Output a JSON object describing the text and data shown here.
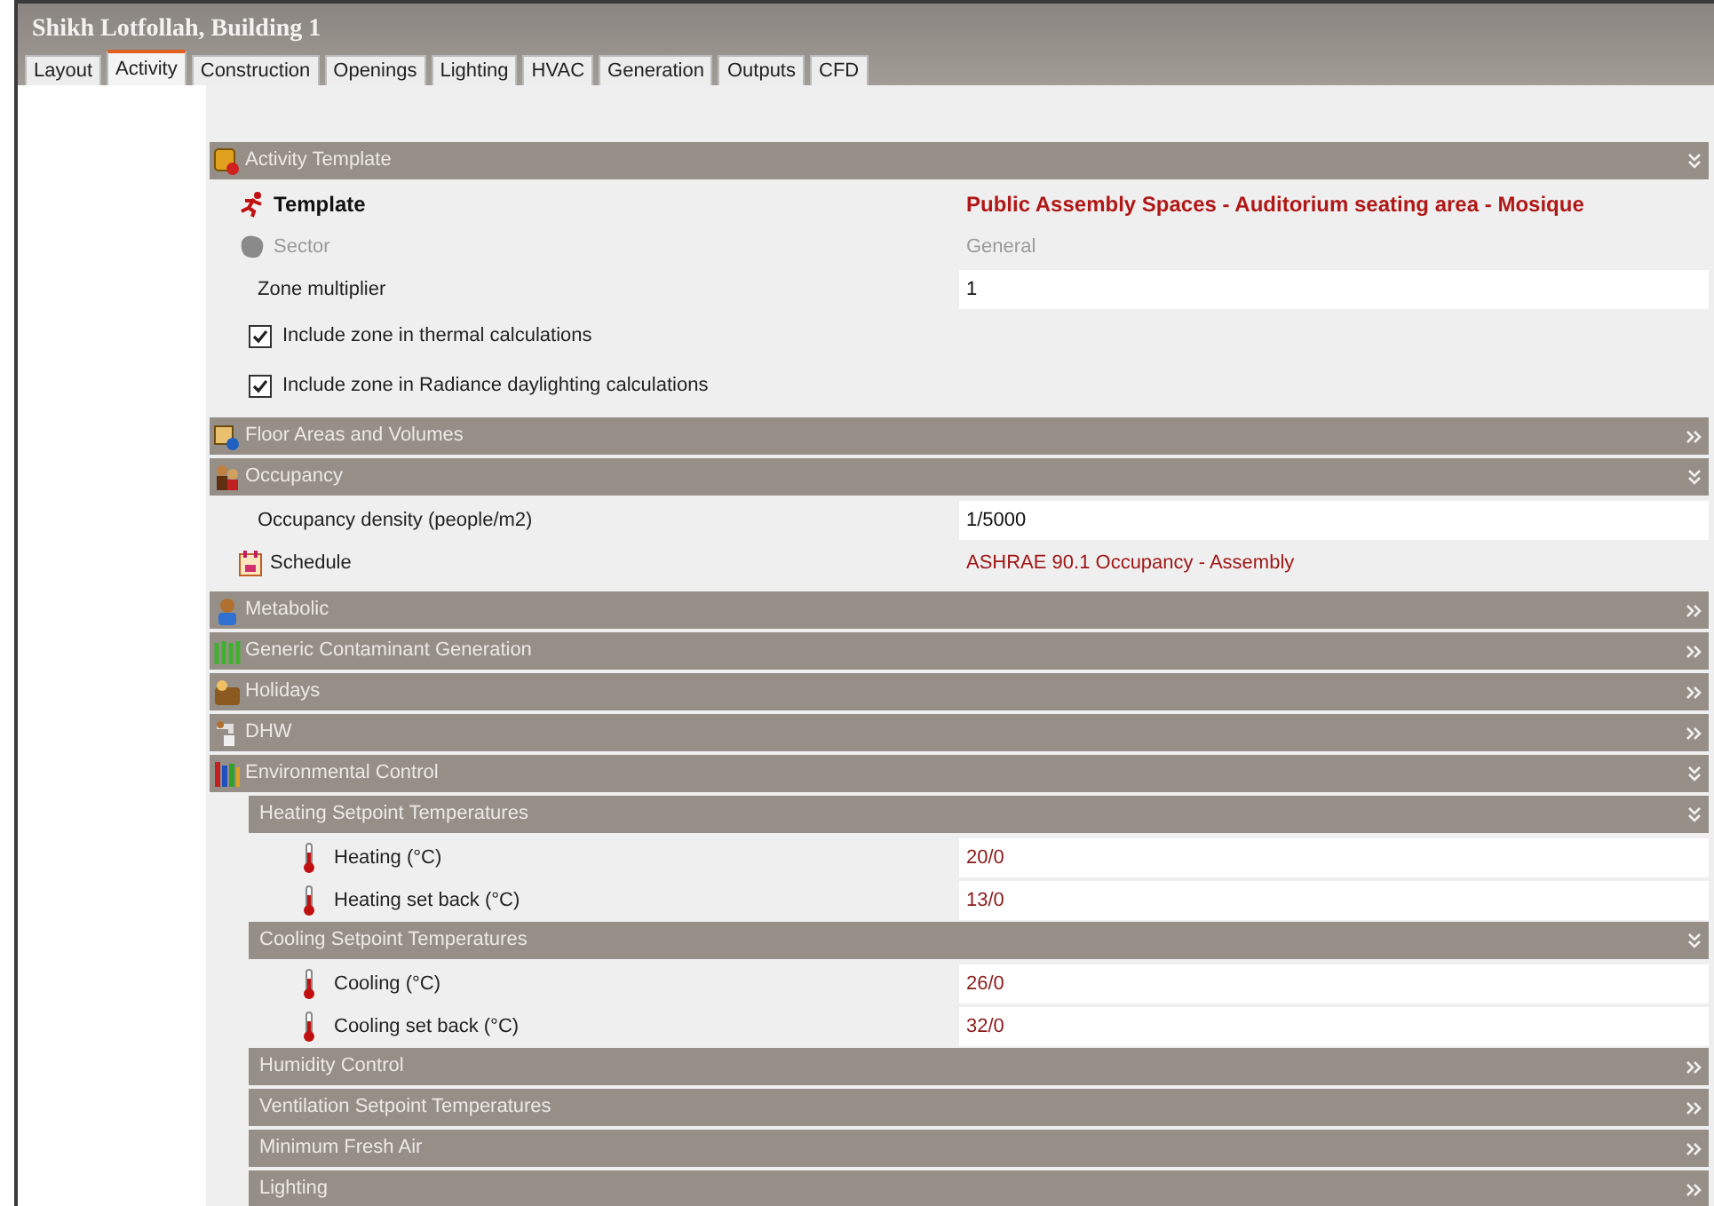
{
  "window": {
    "title": "Shikh Lotfollah, Building 1"
  },
  "tabs": [
    {
      "label": "Layout",
      "selected": false
    },
    {
      "label": "Activity",
      "selected": true
    },
    {
      "label": "Construction",
      "selected": false
    },
    {
      "label": "Openings",
      "selected": false
    },
    {
      "label": "Lighting",
      "selected": false
    },
    {
      "label": "HVAC",
      "selected": false
    },
    {
      "label": "Generation",
      "selected": false
    },
    {
      "label": "Outputs",
      "selected": false
    },
    {
      "label": "CFD",
      "selected": false
    }
  ],
  "sections": [
    {
      "title": "Activity Template",
      "expanded": true,
      "rows": [
        {
          "kind": "template",
          "label": "Template",
          "value": "Public Assembly Spaces - Auditorium seating area - Mosique"
        },
        {
          "kind": "sector",
          "label": "Sector",
          "value": "General"
        },
        {
          "kind": "field",
          "label": "Zone multiplier",
          "value": "1"
        },
        {
          "kind": "checkbox",
          "label": "Include zone in thermal calculations",
          "checked": true
        },
        {
          "kind": "checkbox",
          "label": "Include zone in Radiance daylighting calculations",
          "checked": true
        }
      ]
    },
    {
      "title": "Floor Areas and Volumes",
      "expanded": false
    },
    {
      "title": "Occupancy",
      "expanded": true,
      "rows": [
        {
          "kind": "field",
          "label": "Occupancy density (people/m2)",
          "value": "1/5000"
        },
        {
          "kind": "schedule",
          "label": "Schedule",
          "value": "ASHRAE 90.1 Occupancy - Assembly"
        }
      ]
    },
    {
      "title": "Metabolic",
      "expanded": false
    },
    {
      "title": "Generic Contaminant Generation",
      "expanded": false
    },
    {
      "title": "Holidays",
      "expanded": false
    },
    {
      "title": "DHW",
      "expanded": false
    },
    {
      "title": "Environmental Control",
      "expanded": true,
      "subsections": [
        {
          "title": "Heating Setpoint Temperatures",
          "expanded": true,
          "rows": [
            {
              "kind": "temperature",
              "label": "Heating (°C)",
              "value": "20/0"
            },
            {
              "kind": "temperature",
              "label": "Heating set back (°C)",
              "value": "13/0"
            }
          ]
        },
        {
          "title": "Cooling Setpoint Temperatures",
          "expanded": true,
          "rows": [
            {
              "kind": "temperature",
              "label": "Cooling (°C)",
              "value": "26/0"
            },
            {
              "kind": "temperature",
              "label": "Cooling set back (°C)",
              "value": "32/0"
            }
          ]
        },
        {
          "title": "Humidity Control",
          "expanded": false
        },
        {
          "title": "Ventilation Setpoint Temperatures",
          "expanded": false
        },
        {
          "title": "Minimum Fresh Air",
          "expanded": false
        },
        {
          "title": "Lighting",
          "expanded": false
        }
      ]
    }
  ]
}
